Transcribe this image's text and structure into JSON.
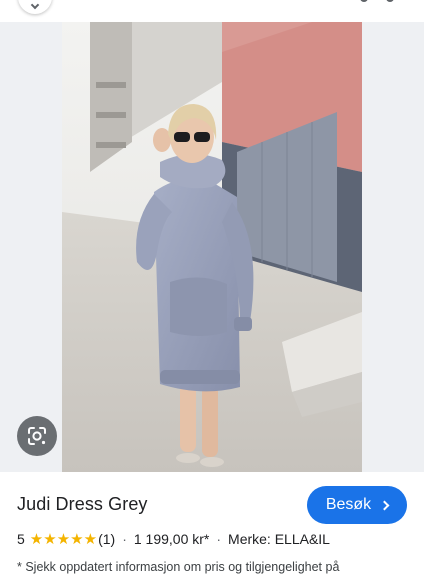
{
  "product": {
    "title": "Judi Dress Grey",
    "rating_value": "5",
    "review_count": "(1)",
    "price": "1 199,00 kr*",
    "brand": "Merke: ELLA&IL",
    "separator": "·",
    "star_glyph": "★",
    "disclaimer": "* Sjekk oppdatert informasjon om pris og tilgjengelighet på"
  },
  "actions": {
    "visit_label": "Besøk"
  },
  "colors": {
    "accent": "#1a73e8",
    "star": "#f4b400",
    "dress": "#9aa3bd"
  },
  "icons": {
    "lens": "google-lens-icon",
    "visit_chevron": "chevron-right-icon"
  }
}
